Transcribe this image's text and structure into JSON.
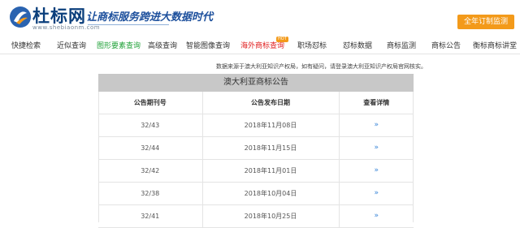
{
  "header": {
    "brand": "杜标网",
    "site_url": "www.shebiaonm.com",
    "slogan": "让商标服务跨进大数据时代",
    "cta_label": "全年订制监测"
  },
  "nav": {
    "items": [
      {
        "label": "快捷检索"
      },
      {
        "label": "近似查询"
      },
      {
        "label": "图形要素查询"
      },
      {
        "label": "高级查询"
      },
      {
        "label": "智能图像查询"
      },
      {
        "label": "海外商标查询"
      },
      {
        "label": "职场怼标"
      },
      {
        "label": "怼标数据"
      },
      {
        "label": "商标监测"
      },
      {
        "label": "商标公告"
      },
      {
        "label": "衡标商标讲堂"
      }
    ],
    "hot_badge": "HOT"
  },
  "notice": "数据来源于澳大利亚知识产权局，如有疑问，请登录澳大利亚知识产权局官网核实。",
  "panel": {
    "title": "澳大利亚商标公告",
    "columns": [
      "公告期刊号",
      "公告发布日期",
      "查看详情"
    ],
    "rows": [
      {
        "issue": "32/43",
        "date": "2018年11月08日",
        "detail": "»"
      },
      {
        "issue": "32/44",
        "date": "2018年11月15日",
        "detail": "»"
      },
      {
        "issue": "32/42",
        "date": "2018年11月01日",
        "detail": "»"
      },
      {
        "issue": "32/38",
        "date": "2018年10月04日",
        "detail": "»"
      },
      {
        "issue": "32/41",
        "date": "2018年10月25日",
        "detail": "»"
      }
    ]
  },
  "colors": {
    "accent": "#f39a1a",
    "brand": "#0b3f7c",
    "active": "#22a23a",
    "hot": "#e02020"
  }
}
